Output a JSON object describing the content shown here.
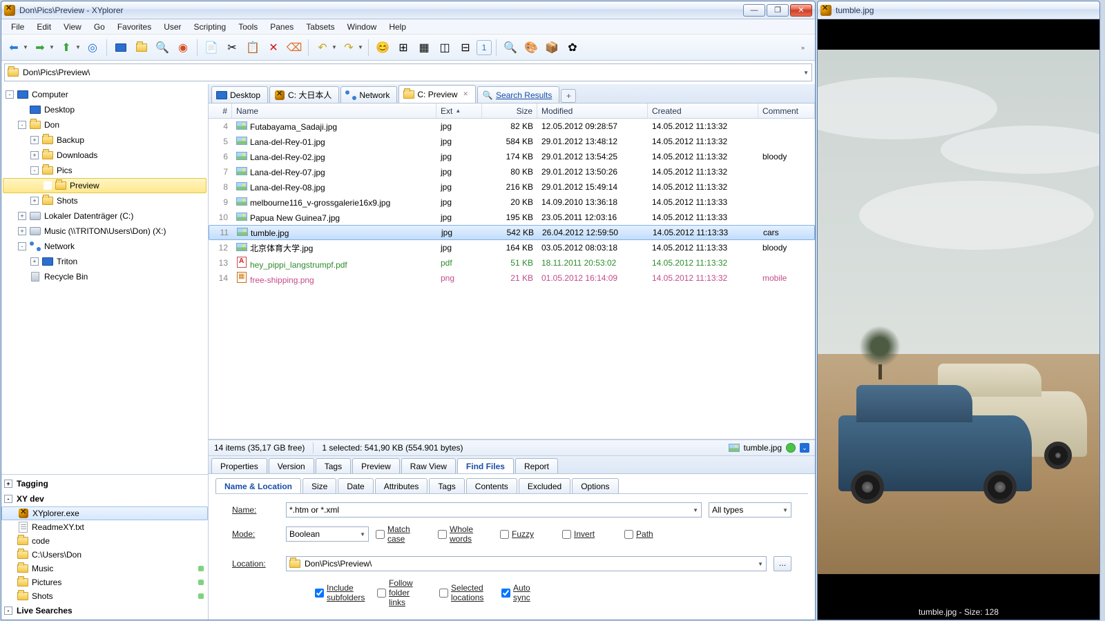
{
  "title": "Don\\Pics\\Preview - XYplorer",
  "menu": [
    "File",
    "Edit",
    "View",
    "Go",
    "Favorites",
    "User",
    "Scripting",
    "Tools",
    "Panes",
    "Tabsets",
    "Window",
    "Help"
  ],
  "address": "Don\\Pics\\Preview\\",
  "tree": [
    {
      "lvl": 0,
      "pm": "-",
      "ico": "mon",
      "label": "Computer"
    },
    {
      "lvl": 1,
      "pm": "",
      "ico": "mon",
      "label": "Desktop"
    },
    {
      "lvl": 1,
      "pm": "-",
      "ico": "folder",
      "label": "Don"
    },
    {
      "lvl": 2,
      "pm": "+",
      "ico": "folder",
      "label": "Backup"
    },
    {
      "lvl": 2,
      "pm": "+",
      "ico": "folder",
      "label": "Downloads"
    },
    {
      "lvl": 2,
      "pm": "-",
      "ico": "folder",
      "label": "Pics"
    },
    {
      "lvl": 3,
      "pm": "",
      "ico": "folder",
      "label": "Preview",
      "sel": true
    },
    {
      "lvl": 2,
      "pm": "+",
      "ico": "folder",
      "label": "Shots"
    },
    {
      "lvl": 1,
      "pm": "+",
      "ico": "disk",
      "label": "Lokaler Datenträger (C:)"
    },
    {
      "lvl": 1,
      "pm": "+",
      "ico": "disk",
      "label": "Music (\\\\TRITON\\Users\\Don) (X:)"
    },
    {
      "lvl": 1,
      "pm": "-",
      "ico": "net",
      "label": "Network"
    },
    {
      "lvl": 2,
      "pm": "+",
      "ico": "mon",
      "label": "Triton"
    },
    {
      "lvl": 1,
      "pm": "",
      "ico": "bin",
      "label": "Recycle Bin"
    }
  ],
  "cats": [
    {
      "type": "head",
      "pm": "+",
      "label": "Tagging"
    },
    {
      "type": "head",
      "pm": "-",
      "label": "XY dev"
    },
    {
      "type": "item",
      "ico": "xy",
      "label": "XYplorer.exe",
      "sel": true
    },
    {
      "type": "item",
      "ico": "txt",
      "label": "ReadmeXY.txt"
    },
    {
      "type": "item",
      "ico": "folder",
      "label": "code"
    },
    {
      "type": "item",
      "ico": "folder",
      "label": "C:\\Users\\Don"
    },
    {
      "type": "item",
      "ico": "folder",
      "label": "Music",
      "dot": true
    },
    {
      "type": "item",
      "ico": "folder",
      "label": "Pictures",
      "dot": true
    },
    {
      "type": "item",
      "ico": "folder",
      "label": "Shots",
      "dot": true
    },
    {
      "type": "head",
      "pm": "-",
      "label": "Live Searches"
    }
  ],
  "tabs": [
    {
      "ico": "mon",
      "label": "Desktop"
    },
    {
      "ico": "xy",
      "label": "C: 大日本人"
    },
    {
      "ico": "net",
      "label": "Network"
    },
    {
      "ico": "folder",
      "label": "C: Preview",
      "active": true,
      "close": true
    },
    {
      "ico": "search",
      "label": "Search Results",
      "search": true
    }
  ],
  "columns": {
    "num": "#",
    "name": "Name",
    "ext": "Ext",
    "size": "Size",
    "mod": "Modified",
    "crt": "Created",
    "com": "Comment"
  },
  "files": [
    {
      "n": 4,
      "ico": "img",
      "name": "Futabayama_Sadaji.jpg",
      "ext": "jpg",
      "size": "82 KB",
      "mod": "12.05.2012 09:28:57",
      "crt": "14.05.2012 11:13:32",
      "com": ""
    },
    {
      "n": 5,
      "ico": "img",
      "name": "Lana-del-Rey-01.jpg",
      "ext": "jpg",
      "size": "584 KB",
      "mod": "29.01.2012 13:48:12",
      "crt": "14.05.2012 11:13:32",
      "com": ""
    },
    {
      "n": 6,
      "ico": "img",
      "name": "Lana-del-Rey-02.jpg",
      "ext": "jpg",
      "size": "174 KB",
      "mod": "29.01.2012 13:54:25",
      "crt": "14.05.2012 11:13:32",
      "com": "bloody"
    },
    {
      "n": 7,
      "ico": "img",
      "name": "Lana-del-Rey-07.jpg",
      "ext": "jpg",
      "size": "80 KB",
      "mod": "29.01.2012 13:50:26",
      "crt": "14.05.2012 11:13:32",
      "com": ""
    },
    {
      "n": 8,
      "ico": "img",
      "name": "Lana-del-Rey-08.jpg",
      "ext": "jpg",
      "size": "216 KB",
      "mod": "29.01.2012 15:49:14",
      "crt": "14.05.2012 11:13:32",
      "com": ""
    },
    {
      "n": 9,
      "ico": "img",
      "name": "melbourne116_v-grossgalerie16x9.jpg",
      "ext": "jpg",
      "size": "20 KB",
      "mod": "14.09.2010 13:36:18",
      "crt": "14.05.2012 11:13:33",
      "com": ""
    },
    {
      "n": 10,
      "ico": "img",
      "name": "Papua New Guinea7.jpg",
      "ext": "jpg",
      "size": "195 KB",
      "mod": "23.05.2011 12:03:16",
      "crt": "14.05.2012 11:13:33",
      "com": ""
    },
    {
      "n": 11,
      "ico": "img",
      "name": "tumble.jpg",
      "ext": "jpg",
      "size": "542 KB",
      "mod": "26.04.2012 12:59:50",
      "crt": "14.05.2012 11:13:33",
      "com": "cars",
      "sel": true
    },
    {
      "n": 12,
      "ico": "img",
      "name": "北京体育大学.jpg",
      "ext": "jpg",
      "size": "164 KB",
      "mod": "03.05.2012 08:03:18",
      "crt": "14.05.2012 11:13:33",
      "com": "bloody"
    },
    {
      "n": 13,
      "ico": "pdf",
      "name": "hey_pippi_langstrumpf.pdf",
      "ext": "pdf",
      "size": "51 KB",
      "mod": "18.11.2011 20:53:02",
      "crt": "14.05.2012 11:13:32",
      "com": "",
      "cls": "row-green"
    },
    {
      "n": 14,
      "ico": "png",
      "name": "free-shipping.png",
      "ext": "png",
      "size": "21 KB",
      "mod": "01.05.2012 16:14:09",
      "crt": "14.05.2012 11:13:32",
      "com": "mobile",
      "cls": "row-pink"
    }
  ],
  "status": {
    "left": "14 items (35,17 GB free)",
    "mid": "1 selected: 541,90 KB (554.901 bytes)",
    "file": "tumble.jpg"
  },
  "btabs": [
    "Properties",
    "Version",
    "Tags",
    "Preview",
    "Raw View",
    "Find Files",
    "Report"
  ],
  "btab_active": "Find Files",
  "ftabs": [
    "Name & Location",
    "Size",
    "Date",
    "Attributes",
    "Tags",
    "Contents",
    "Excluded",
    "Options"
  ],
  "ftab_active": "Name & Location",
  "find": {
    "name_label": "Name:",
    "name_value": "*.htm or *.xml",
    "types": "All types",
    "mode_label": "Mode:",
    "mode_value": "Boolean",
    "chk_match": "Match case",
    "chk_whole": "Whole words",
    "chk_fuzzy": "Fuzzy",
    "chk_invert": "Invert",
    "chk_path": "Path",
    "loc_label": "Location:",
    "loc_value": "Don\\Pics\\Preview\\",
    "chk_sub": "Include subfolders",
    "chk_follow": "Follow folder links",
    "chk_selloc": "Selected locations",
    "chk_auto": "Auto sync"
  },
  "preview": {
    "title": "tumble.jpg",
    "status": "tumble.jpg - Size: 128"
  }
}
